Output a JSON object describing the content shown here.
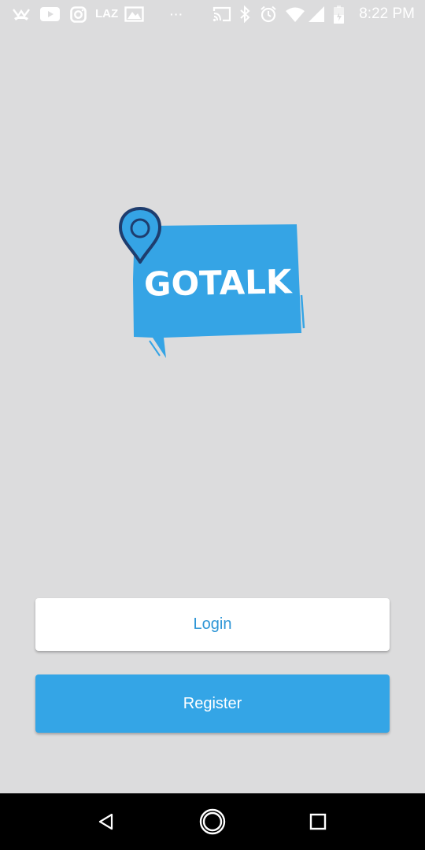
{
  "status_bar": {
    "left_icons": [
      "missed-call-icon",
      "youtube-icon",
      "instagram-icon",
      "lazada-icon",
      "gallery-icon",
      "more-dots-icon"
    ],
    "lazada_label": "LAZ",
    "more_label": "···",
    "right_icons": [
      "cast-icon",
      "bluetooth-icon",
      "alarm-icon",
      "wifi-icon",
      "signal-icon",
      "battery-icon"
    ],
    "time": "8:22 PM"
  },
  "logo": {
    "text": "GOTALK",
    "colors": {
      "bubble": "#35A4E5",
      "pin": "#35A4E5",
      "pin_outline": "#1E3D6E",
      "text": "#FFFFFF"
    }
  },
  "actions": {
    "login_label": "Login",
    "register_label": "Register"
  },
  "colors": {
    "background": "#DCDCDD",
    "accent": "#34A5E6",
    "login_text": "#2F96D6"
  },
  "nav_bar": {
    "buttons": [
      "back-icon",
      "home-icon",
      "recents-icon"
    ]
  }
}
